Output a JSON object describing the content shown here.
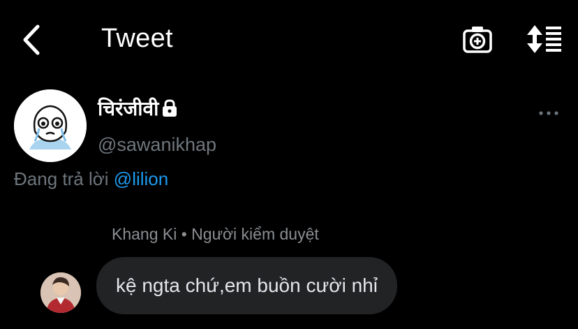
{
  "header": {
    "title": "Tweet",
    "back_icon": "chevron-left-icon",
    "camera_icon": "camera-add-icon",
    "sort_icon": "sort-icon"
  },
  "tweet": {
    "display_name": "चिरंजीवी",
    "protected_icon": "lock-icon",
    "handle": "@sawanikhap",
    "more_icon": "more-horizontal-icon",
    "reply_prefix": "Đang trả lời",
    "reply_to": "@lilion"
  },
  "embedded_comment": {
    "meta": "Khang Ki • Người kiểm duyệt",
    "text": "kệ ngta chứ,em buồn cười nhỉ"
  },
  "colors": {
    "background": "#000000",
    "mention": "#1d9bf0",
    "secondary_text": "#6e767d",
    "bubble": "#222325"
  }
}
